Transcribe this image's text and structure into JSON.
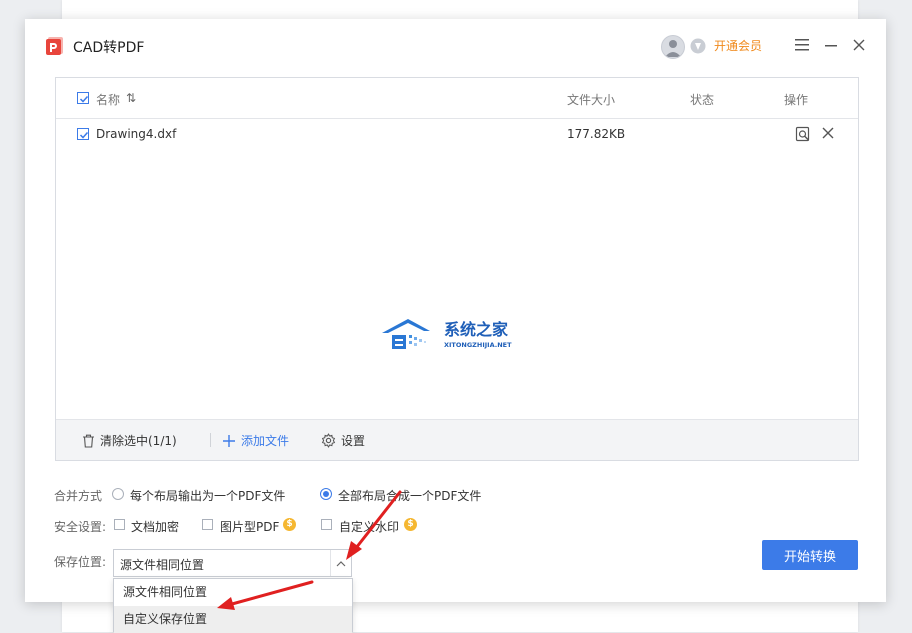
{
  "app": {
    "title": "CAD转PDF",
    "vip_label": "开通会员"
  },
  "colors": {
    "accent": "#3c7be8",
    "vip": "#f08a1d",
    "logo": "#e8453c",
    "arrow": "#e02020",
    "coin": "#f5b731"
  },
  "table": {
    "headers": {
      "name": "名称",
      "sort_glyph": "⇅",
      "size": "文件大小",
      "status": "状态",
      "action": "操作"
    },
    "rows": [
      {
        "name": "Drawing4.dxf",
        "size": "177.82KB",
        "status": "",
        "checked": true
      }
    ]
  },
  "watermark": {
    "title": "系统之家",
    "subtitle": "XITONGZHIJIA.NET"
  },
  "toolbar": {
    "clear_label": "清除选中(1/1)",
    "add_label": "添加文件",
    "settings_label": "设置"
  },
  "merge": {
    "label": "合并方式",
    "option1": "每个布局输出为一个PDF文件",
    "option2": "全部布局合成一个PDF文件",
    "selected": "option2"
  },
  "security": {
    "label": "安全设置:",
    "encrypt": "文档加密",
    "image_pdf": "图片型PDF",
    "watermark": "自定义水印",
    "coin_glyph": "$"
  },
  "save": {
    "label": "保存位置:",
    "value": "源文件相同位置",
    "options": [
      "源文件相同位置",
      "自定义保存位置"
    ],
    "hovered_index": 1
  },
  "actions": {
    "start_label": "开始转换"
  },
  "icons": [
    "pdf-logo-icon",
    "avatar",
    "vip-coin-icon",
    "menu-icon",
    "minimize-icon",
    "close-icon",
    "checkbox-icon",
    "sort-icon",
    "preview-icon",
    "remove-icon",
    "trash-icon",
    "plus-icon",
    "gear-icon",
    "chevron-up-icon"
  ]
}
